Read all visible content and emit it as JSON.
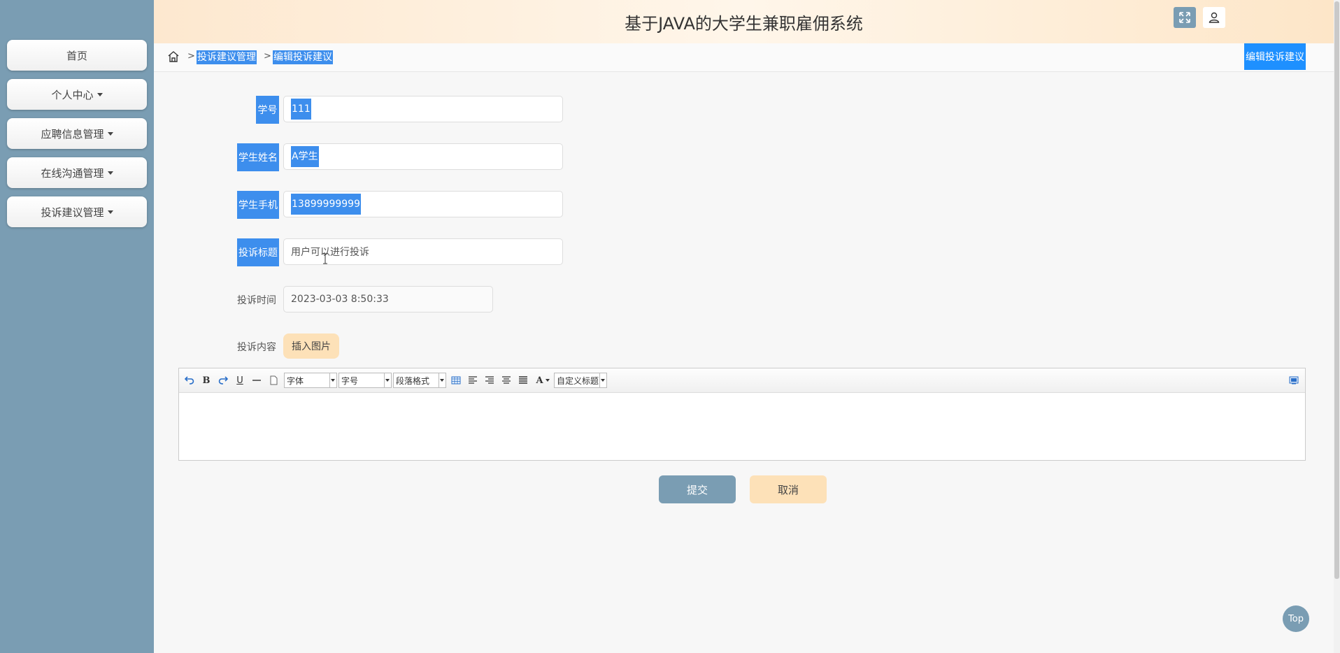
{
  "app": {
    "title": "基于JAVA的大学生兼职雇佣系统"
  },
  "sidebar": {
    "items": [
      {
        "label": "首页",
        "has_caret": false
      },
      {
        "label": "个人中心",
        "has_caret": true
      },
      {
        "label": "应聘信息管理",
        "has_caret": true
      },
      {
        "label": "在线沟通管理",
        "has_caret": true
      },
      {
        "label": "投诉建议管理",
        "has_caret": true
      }
    ]
  },
  "header": {
    "icons": [
      "fullscreen-icon",
      "user-icon"
    ],
    "colors": {
      "fullscreen_bg": "#7a9db3"
    }
  },
  "breadcrumb": {
    "sep": ">",
    "items": [
      "投诉建议管理",
      "编辑投诉建议"
    ],
    "right_label": "编辑投诉建议"
  },
  "form": {
    "student_id": {
      "label": "学号",
      "value": "111"
    },
    "student_name": {
      "label": "学生姓名",
      "value": "A学生"
    },
    "student_phone": {
      "label": "学生手机",
      "value": "13899999999"
    },
    "complaint_title": {
      "label": "投诉标题",
      "value": "用户可以进行投诉"
    },
    "complaint_time": {
      "label": "投诉时间",
      "value": "2023-03-03 8:50:33"
    },
    "complaint_content": {
      "label": "投诉内容",
      "insert_image": "插入图片"
    }
  },
  "editor": {
    "font_select": "字体",
    "size_select": "字号",
    "paragraph_select": "段落格式",
    "custom_title_select": "自定义标题",
    "bold": "B",
    "underline": "U",
    "font_color": "A"
  },
  "actions": {
    "submit": "提交",
    "cancel": "取消",
    "top": "Top"
  },
  "colors": {
    "sidebar": "#7a9db3",
    "highlight": "#3d8eed",
    "accent_button": "#fde1b8",
    "breadcrumb_right": "#1e90ff"
  }
}
